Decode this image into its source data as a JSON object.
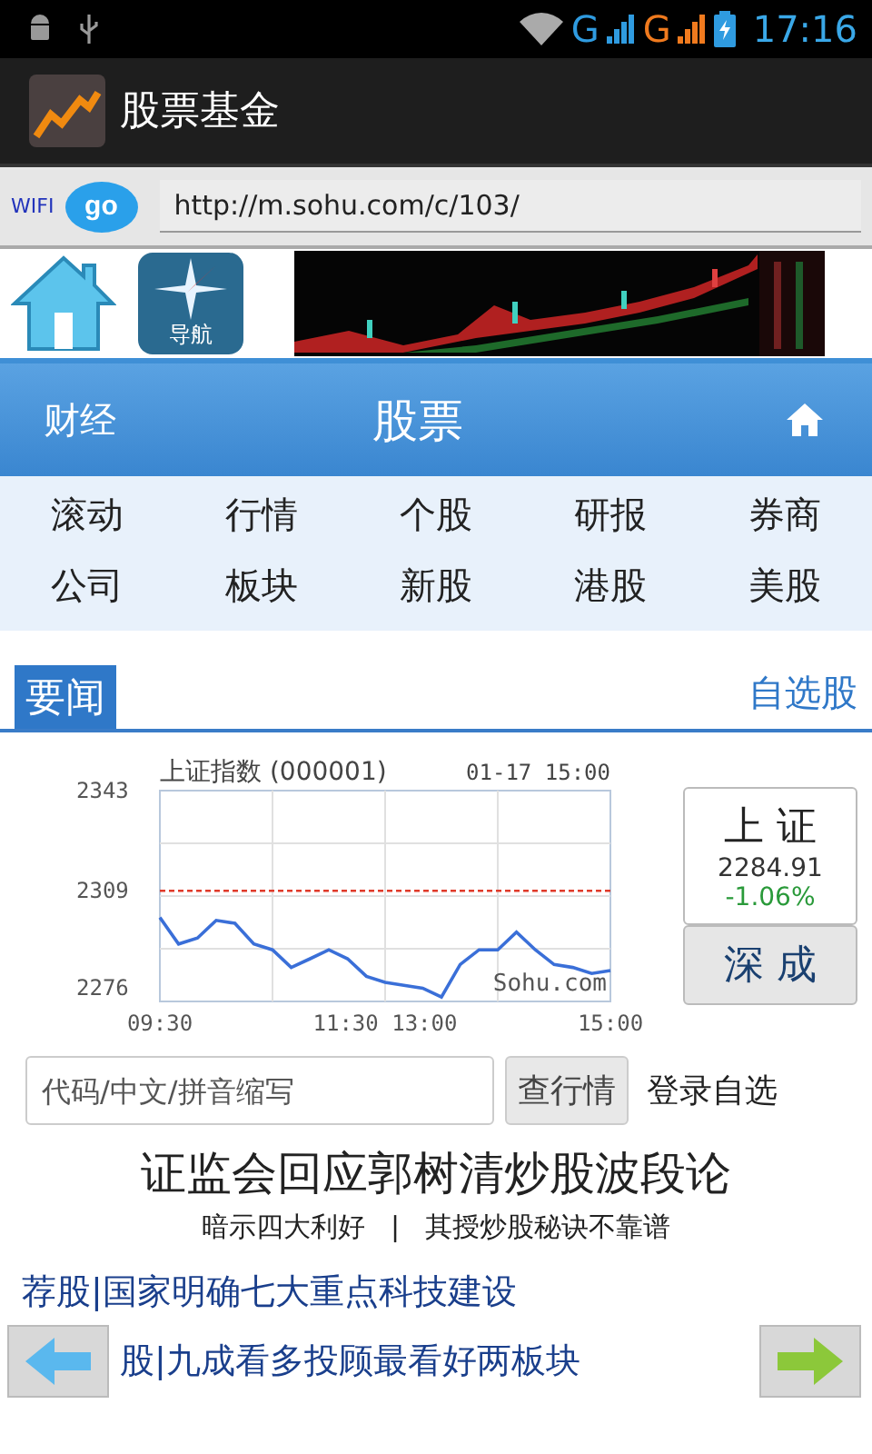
{
  "status_bar": {
    "networks": [
      {
        "label": "G",
        "color": "#2f9be0"
      },
      {
        "label": "G",
        "color": "#f07a1e"
      }
    ],
    "time": "17:16"
  },
  "app_bar": {
    "title": "股票基金"
  },
  "url_bar": {
    "wifi_label": "WIFI",
    "go_label": "go",
    "url": "http://m.sohu.com/c/103/"
  },
  "banner": {
    "nav_label": "导航"
  },
  "nav_bar": {
    "left": "财经",
    "title": "股票"
  },
  "categories": [
    {
      "label": "滚动"
    },
    {
      "label": "行情"
    },
    {
      "label": "个股"
    },
    {
      "label": "研报"
    },
    {
      "label": "券商"
    },
    {
      "label": "公司"
    },
    {
      "label": "板块"
    },
    {
      "label": "新股"
    },
    {
      "label": "港股"
    },
    {
      "label": "美股"
    }
  ],
  "section": {
    "title": "要闻",
    "link": "自选股"
  },
  "index_chart": {
    "timestamp": "01-17 15:00",
    "watermark": "Sohu.com",
    "chart_data": {
      "type": "line",
      "title": "上证指数 (000001)",
      "categories": [
        "09:30",
        null,
        null,
        null,
        null,
        null,
        null,
        null,
        null,
        null,
        null,
        null,
        "11:30 13:00",
        null,
        null,
        null,
        null,
        null,
        null,
        null,
        null,
        null,
        null,
        null,
        "15:00"
      ],
      "series": [
        {
          "color": "#3a6fd8",
          "values": [
            2300,
            2291,
            2293,
            2299,
            2298,
            2291,
            2289,
            2283,
            2286,
            2289,
            2286,
            2280,
            2278,
            2277,
            2276,
            2273,
            2284,
            2289,
            2289,
            2295,
            2289,
            2284,
            2283,
            2281,
            2282
          ]
        }
      ],
      "ylim": [
        2271.5,
        2343
      ],
      "yticks": [
        2343,
        2309,
        2276
      ],
      "grid": true,
      "ref_lines": [
        {
          "axis": "y",
          "value": 2309,
          "color": "#e03a2a"
        }
      ]
    }
  },
  "index_tabs": [
    {
      "label": "上 证",
      "selected": true,
      "value": "2284.91",
      "change": "-1.06%"
    },
    {
      "label": "深 成",
      "selected": false
    }
  ],
  "quote_search": {
    "placeholder": "代码/中文/拼音缩写",
    "button": "查行情",
    "login": "登录自选"
  },
  "headline": {
    "title": "证监会回应郭树清炒股波段论",
    "subtitles": [
      "暗示四大利好",
      "其授炒股秘诀不靠谱"
    ],
    "separator": "|"
  },
  "links": [
    "荐股|国家明确七大重点科技建设",
    "股|九成看多投顾最看好两板块"
  ]
}
